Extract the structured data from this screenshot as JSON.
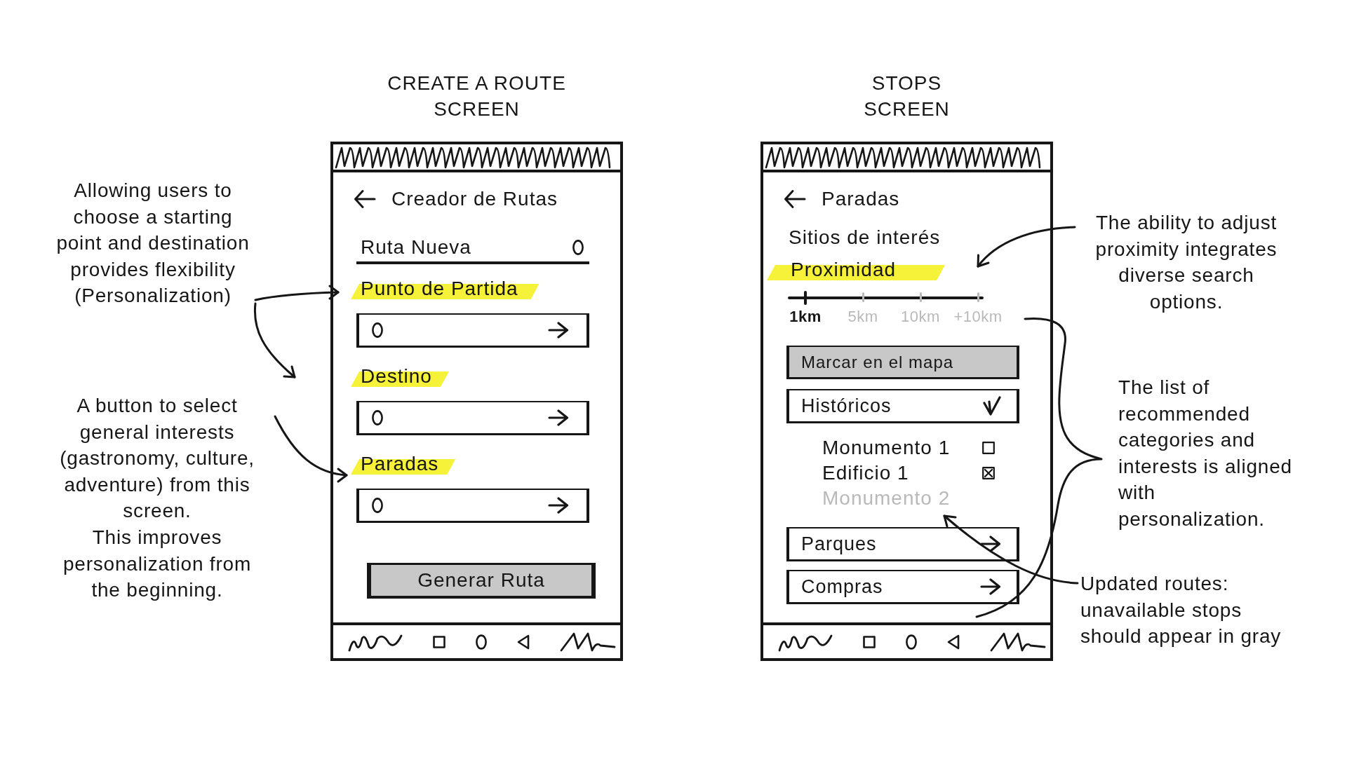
{
  "create_route_screen": {
    "heading": "CREATE A ROUTE\nSCREEN",
    "title": "Creador de Rutas",
    "route_name": {
      "value": "Ruta Nueva"
    },
    "sections": [
      {
        "label": "Punto de Partida"
      },
      {
        "label": "Destino"
      },
      {
        "label": "Paradas"
      }
    ],
    "generate_button": "Generar Ruta"
  },
  "stops_screen": {
    "heading": "STOPS\nSCREEN",
    "title": "Paradas",
    "subtitle": "Sitios de interés",
    "proximity": {
      "label": "Proximidad",
      "options": [
        {
          "label": "1km",
          "selected": true
        },
        {
          "label": "5km",
          "selected": false
        },
        {
          "label": "10km",
          "selected": false
        },
        {
          "label": "+10km",
          "selected": false
        }
      ]
    },
    "map_button": "Marcar en el mapa",
    "categories": [
      {
        "label": "Históricos",
        "expanded": true,
        "items": [
          {
            "label": "Monumento 1",
            "available": true,
            "checked": false
          },
          {
            "label": "Edificio 1",
            "available": true,
            "checked": true
          },
          {
            "label": "Monumento 2",
            "available": false
          }
        ]
      },
      {
        "label": "Parques",
        "expanded": false
      },
      {
        "label": "Compras",
        "expanded": false
      }
    ]
  },
  "notes_left": [
    "Allowing users to\nchoose a starting\npoint and destination\nprovides flexibility\n(Personalization)",
    "A button to select\ngeneral interests\n(gastronomy, culture,\nadventure) from this\nscreen.\nThis improves\npersonalization from\nthe beginning."
  ],
  "notes_right": [
    "The ability to adjust\nproximity integrates\ndiverse search\noptions.",
    "The list of\nrecommended\ncategories and\ninterests is aligned\nwith\npersonalization.",
    "Updated routes:\nunavailable stops\nshould appear in gray"
  ]
}
